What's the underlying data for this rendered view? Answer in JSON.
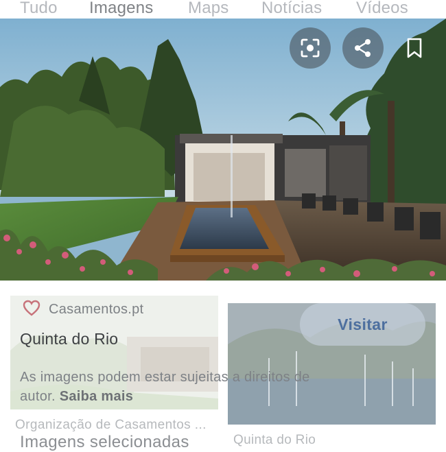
{
  "tabs": [
    {
      "label": "Tudo",
      "active": false
    },
    {
      "label": "Imagens",
      "active": true
    },
    {
      "label": "Maps",
      "active": false
    },
    {
      "label": "Notícias",
      "active": false
    },
    {
      "label": "Vídeos",
      "active": false
    }
  ],
  "hero": {
    "actions": [
      {
        "icon": "lens-icon"
      },
      {
        "icon": "share-icon"
      },
      {
        "icon": "bookmark-icon"
      }
    ]
  },
  "result": {
    "source_name": "Casamentos.pt",
    "source_icon": "heart-icon",
    "source_color": "#c0392b",
    "title": "Quinta do Rio",
    "visit_label": "Visitar",
    "copyright_text": "As imagens podem estar sujeitas a direitos de autor.",
    "learn_more": "Saiba mais"
  },
  "below": {
    "left_caption": "Organização de Casamentos ...",
    "right_caption": "Quinta do Rio",
    "section_heading": "Imagens selecionadas"
  },
  "colors": {
    "accent": "#4d6f9f",
    "tab_inactive": "#b5b8bd",
    "tab_active": "#7f8286"
  }
}
